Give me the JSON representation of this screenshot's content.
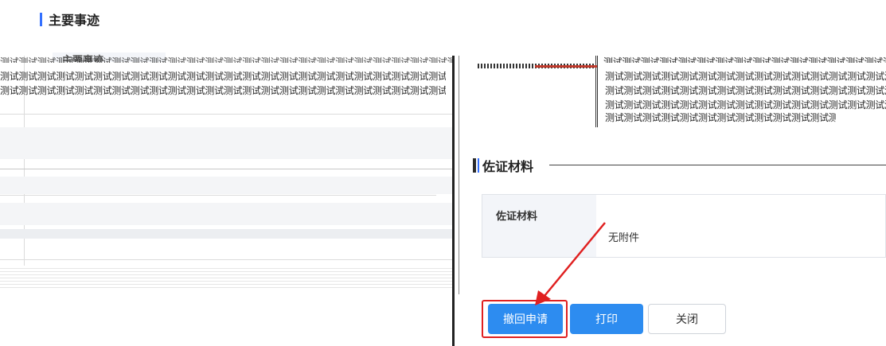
{
  "background": {
    "section_title": "主要事迹",
    "field_label": "主要事迹",
    "glitch_text_row1": "测试测试测试测试测试测试测试测试测试测试测试测试测试测试测试测试测试测试测试测试测试测试测试测试测试测试测试测试测试测试测试测试测试测试测试测试测试测试测试测试测试测试测试测试测试测试测试测试测试测试测试测试测试测试测试测试",
    "glitch_text_row2": "测试测试测试测试测试测试测试测试测试测试测试测试测试测试测试测试测试测试测试测试测试测试测试测试测试测试测试测试测试测试测试测试测试测试测试测试测试测试",
    "glitch_text_row3": "测试测试测试测试测试测试测试测试测试测试测试测试测试测试测试测试测试测试测试测试测试测试测试测试测试测试测试测试测试测试测试测试测试测试测试测试测试测试"
  },
  "dialog": {
    "right_text_row1": "测试测试测试测试测试测试测试测试测试测试测试测试测试测试测试测试测试测试测试测试测试测试测试测试测试测试测试测试测试测试测试测试测试测试",
    "right_text_row2": "测试测试测试测试测试测试测试测试测试测试测试测试测试测试测试测试测试测试测试测试测试测试测试测试测试测试测试测试测试测试测试测试测试测试",
    "right_text_row3": "测试测试测试测试测试测试测试测试测试测试测试测试测试测试测试测试测试测试测试测试测试测试测试测试测试测试测试测试测试测试测试测试测试测试",
    "right_text_row4": "测试测试测试测试测试测试测试测试测试测试测试测试测试测试测试测试测试测试测试测试测试测试测试测试测试测试测试测试测试测试测试测试测试测试",
    "right_text_row5": "测试测试测试测试测试测试测试测试测试测试测试测试测试测试测试测试测试测试测试测试测试测试测试测试测试测试测试测试测试测试测试测试测试测试",
    "evidence_section_title": "佐证材料",
    "evidence_label": "佐证材料",
    "evidence_value": "无附件",
    "buttons": {
      "withdraw": "撤回申请",
      "print": "打印",
      "close": "关闭"
    }
  },
  "colors": {
    "primary": "#2d8cf0",
    "accent_bar": "#3370ff",
    "highlight": "#e02020"
  }
}
